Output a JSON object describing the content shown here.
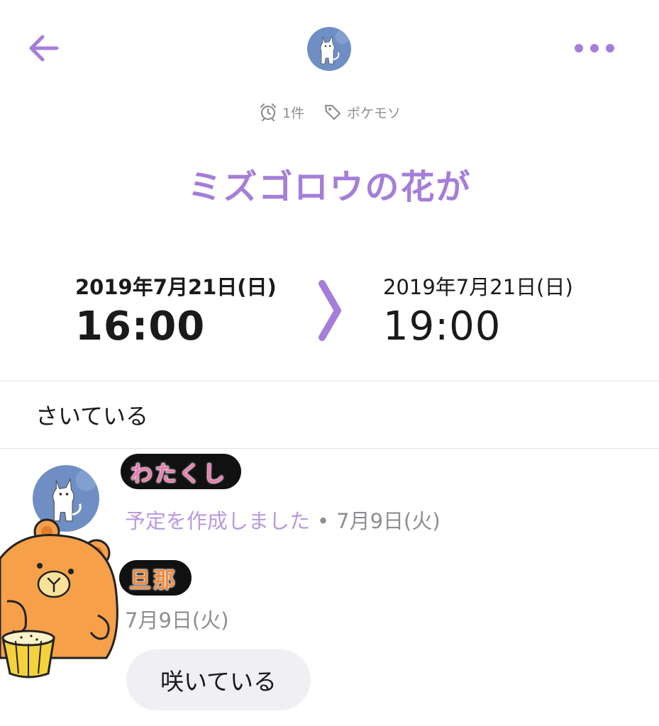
{
  "header": {
    "back_icon": "arrow-left-icon",
    "more_icon": "more-dots-icon",
    "accent_color": "#a57ed9"
  },
  "meta": {
    "reminder_icon": "alarm-clock-icon",
    "reminder_count": "1件",
    "tag_icon": "tag-icon",
    "tag_label": "ポケモソ"
  },
  "event": {
    "title": "ミズゴロウの花が",
    "start": {
      "date": "2019年7月21日(日)",
      "time": "16:00"
    },
    "end": {
      "date": "2019年7月21日(日)",
      "time": "19:00"
    },
    "memo": "さいている"
  },
  "activity": {
    "creator_name": "わたくし",
    "action": "予定を作成しました",
    "separator": "•",
    "date": "7月9日(火)"
  },
  "comment": {
    "author_name": "旦那",
    "date": "7月9日(火)",
    "text": "咲いている"
  }
}
